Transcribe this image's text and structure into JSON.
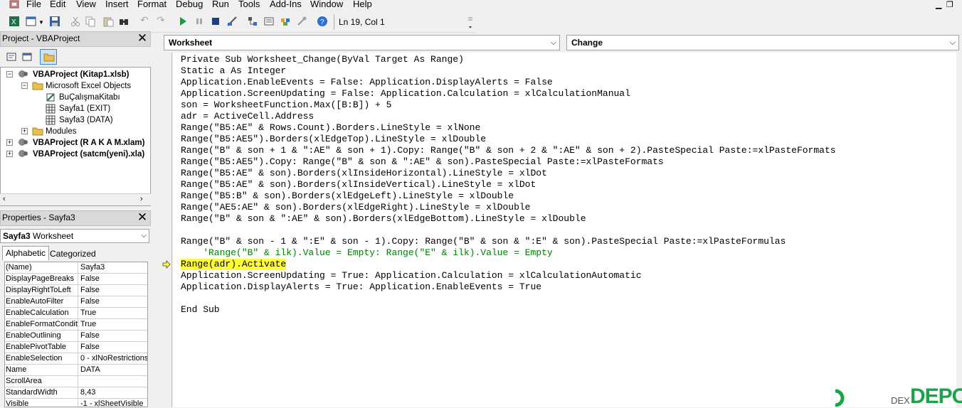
{
  "menu": {
    "file": "File",
    "edit": "Edit",
    "view": "View",
    "insert": "Insert",
    "format": "Format",
    "debug": "Debug",
    "run": "Run",
    "tools": "Tools",
    "addins": "Add-Ins",
    "window": "Window",
    "help": "Help"
  },
  "toolbar": {
    "position": "Ln 19, Col 1"
  },
  "project_panel": {
    "title": "Project - VBAProject",
    "close_label": "✕",
    "tree": [
      {
        "label": "VBAProject (Kitap1.xlsb)",
        "bold": true
      },
      {
        "label": "Microsoft Excel Objects",
        "bold": false
      },
      {
        "label": "BuÇalışmaKitabı",
        "bold": false
      },
      {
        "label": "Sayfa1 (EXIT)",
        "bold": false
      },
      {
        "label": "Sayfa3 (DATA)",
        "bold": false
      },
      {
        "label": "Modules",
        "bold": false
      },
      {
        "label": "VBAProject (R A K A M.xlam)",
        "bold": true
      },
      {
        "label": "VBAProject (satcm(yeni).xla)",
        "bold": true
      }
    ]
  },
  "properties_panel": {
    "title": "Properties - Sayfa3",
    "close_label": "✕",
    "object_name": "Sayfa3",
    "object_type": "Worksheet",
    "tabs": [
      "Alphabetic",
      "Categorized"
    ],
    "rows": [
      {
        "name": "(Name)",
        "value": "Sayfa3"
      },
      {
        "name": "DisplayPageBreaks",
        "value": "False"
      },
      {
        "name": "DisplayRightToLeft",
        "value": "False"
      },
      {
        "name": "EnableAutoFilter",
        "value": "False"
      },
      {
        "name": "EnableCalculation",
        "value": "True"
      },
      {
        "name": "EnableFormatConditions",
        "value": "True"
      },
      {
        "name": "EnableOutlining",
        "value": "False"
      },
      {
        "name": "EnablePivotTable",
        "value": "False"
      },
      {
        "name": "EnableSelection",
        "value": "0 - xlNoRestrictions"
      },
      {
        "name": "Name",
        "value": "DATA"
      },
      {
        "name": "ScrollArea",
        "value": ""
      },
      {
        "name": "StandardWidth",
        "value": "8,43"
      },
      {
        "name": "Visible",
        "value": "-1 - xlSheetVisible"
      }
    ]
  },
  "code_window": {
    "object_combo": "Worksheet",
    "procedure_combo": "Change",
    "lines": [
      {
        "text": "Private Sub Worksheet_Change(ByVal Target As Range)",
        "style": "normal"
      },
      {
        "text": "Static a As Integer",
        "style": "normal"
      },
      {
        "text": "Application.EnableEvents = False: Application.DisplayAlerts = False",
        "style": "normal"
      },
      {
        "text": "Application.ScreenUpdating = False: Application.Calculation = xlCalculationManual",
        "style": "normal"
      },
      {
        "text": "son = WorksheetFunction.Max([B:B]) + 5",
        "style": "normal"
      },
      {
        "text": "adr = ActiveCell.Address",
        "style": "normal"
      },
      {
        "text": "Range(\"B5:AE\" & Rows.Count).Borders.LineStyle = xlNone",
        "style": "normal"
      },
      {
        "text": "Range(\"B5:AE5\").Borders(xlEdgeTop).LineStyle = xlDouble",
        "style": "normal"
      },
      {
        "text": "Range(\"B\" & son + 1 & \":AE\" & son + 1).Copy: Range(\"B\" & son + 2 & \":AE\" & son + 2).PasteSpecial Paste:=xlPasteFormats",
        "style": "normal"
      },
      {
        "text": "Range(\"B5:AE5\").Copy: Range(\"B\" & son & \":AE\" & son).PasteSpecial Paste:=xlPasteFormats",
        "style": "normal"
      },
      {
        "text": "Range(\"B5:AE\" & son).Borders(xlInsideHorizontal).LineStyle = xlDot",
        "style": "normal"
      },
      {
        "text": "Range(\"B5:AE\" & son).Borders(xlInsideVertical).LineStyle = xlDot",
        "style": "normal"
      },
      {
        "text": "Range(\"B5:B\" & son).Borders(xlEdgeLeft).LineStyle = xlDouble",
        "style": "normal"
      },
      {
        "text": "Range(\"AE5:AE\" & son).Borders(xlEdgeRight).LineStyle = xlDouble",
        "style": "normal"
      },
      {
        "text": "Range(\"B\" & son & \":AE\" & son).Borders(xlEdgeBottom).LineStyle = xlDouble",
        "style": "normal"
      },
      {
        "text": "",
        "style": "normal"
      },
      {
        "text": "Range(\"B\" & son - 1 & \":E\" & son - 1).Copy: Range(\"B\" & son & \":E\" & son).PasteSpecial Paste:=xlPasteFormulas",
        "style": "normal"
      },
      {
        "text": "    'Range(\"B\" & ilk).Value = Empty: Range(\"E\" & ilk).Value = Empty",
        "style": "comment"
      },
      {
        "text": "Range(adr).Activate",
        "style": "highlight"
      },
      {
        "text": "Application.ScreenUpdating = True: Application.Calculation = xlCalculationAutomatic",
        "style": "normal"
      },
      {
        "text": "Application.DisplayAlerts = True: Application.EnableEvents = True",
        "style": "normal"
      },
      {
        "text": "",
        "style": "normal"
      },
      {
        "text": "End Sub",
        "style": "normal"
      }
    ]
  },
  "watermark": {
    "text": "DEX",
    "brand": "DEPO"
  },
  "colors": {
    "highlight": "#ffff33",
    "comment": "#008000",
    "brand": "#1aa34a"
  }
}
